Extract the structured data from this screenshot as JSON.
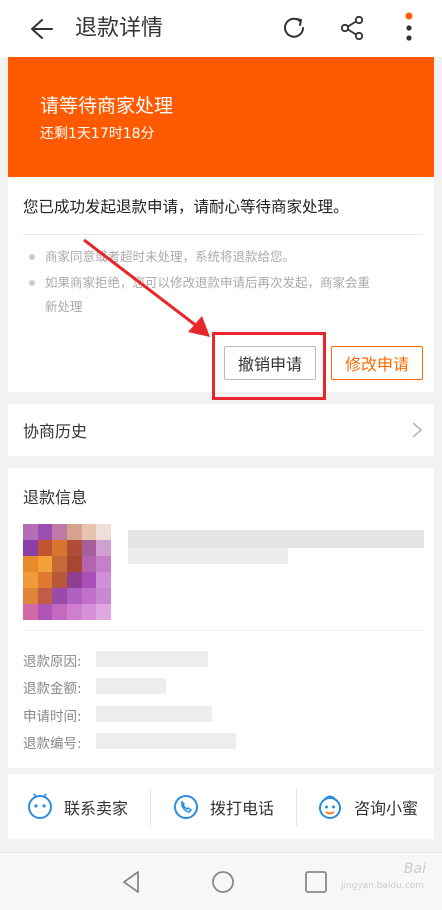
{
  "header": {
    "title": "退款详情",
    "icons": [
      "back-arrow-icon",
      "refresh-icon",
      "share-icon",
      "more-vertical-icon"
    ]
  },
  "banner": {
    "title": "请等待商家处理",
    "countdown": "还剩1天17时18分",
    "color": "#ff5a00"
  },
  "status": {
    "message": "您已成功发起退款申请，请耐心等待商家处理。",
    "notes": [
      "商家同意或者超时未处理，系统将退款给您。",
      "如果商家拒绝，您可以修改退款申请后再次发起，商家会重",
      "新处理"
    ],
    "cancel_label": "撤销申请",
    "modify_label": "修改申请"
  },
  "history": {
    "label": "协商历史"
  },
  "refund_info": {
    "title": "退款信息",
    "fields": {
      "reason": "退款原因:",
      "amount": "退款金额:",
      "time": "申请时间:",
      "number": "退款编号:"
    }
  },
  "actions": {
    "contact_seller": "联系卖家",
    "call": "拨打电话",
    "consult": "咨询小蜜"
  },
  "watermark": {
    "brand": "Bai",
    "sub": "jingyan.baidu.com"
  },
  "colors": {
    "accent": "#ff6a00",
    "highlight": "#e8262b",
    "action_icon": "#2a8de0"
  }
}
